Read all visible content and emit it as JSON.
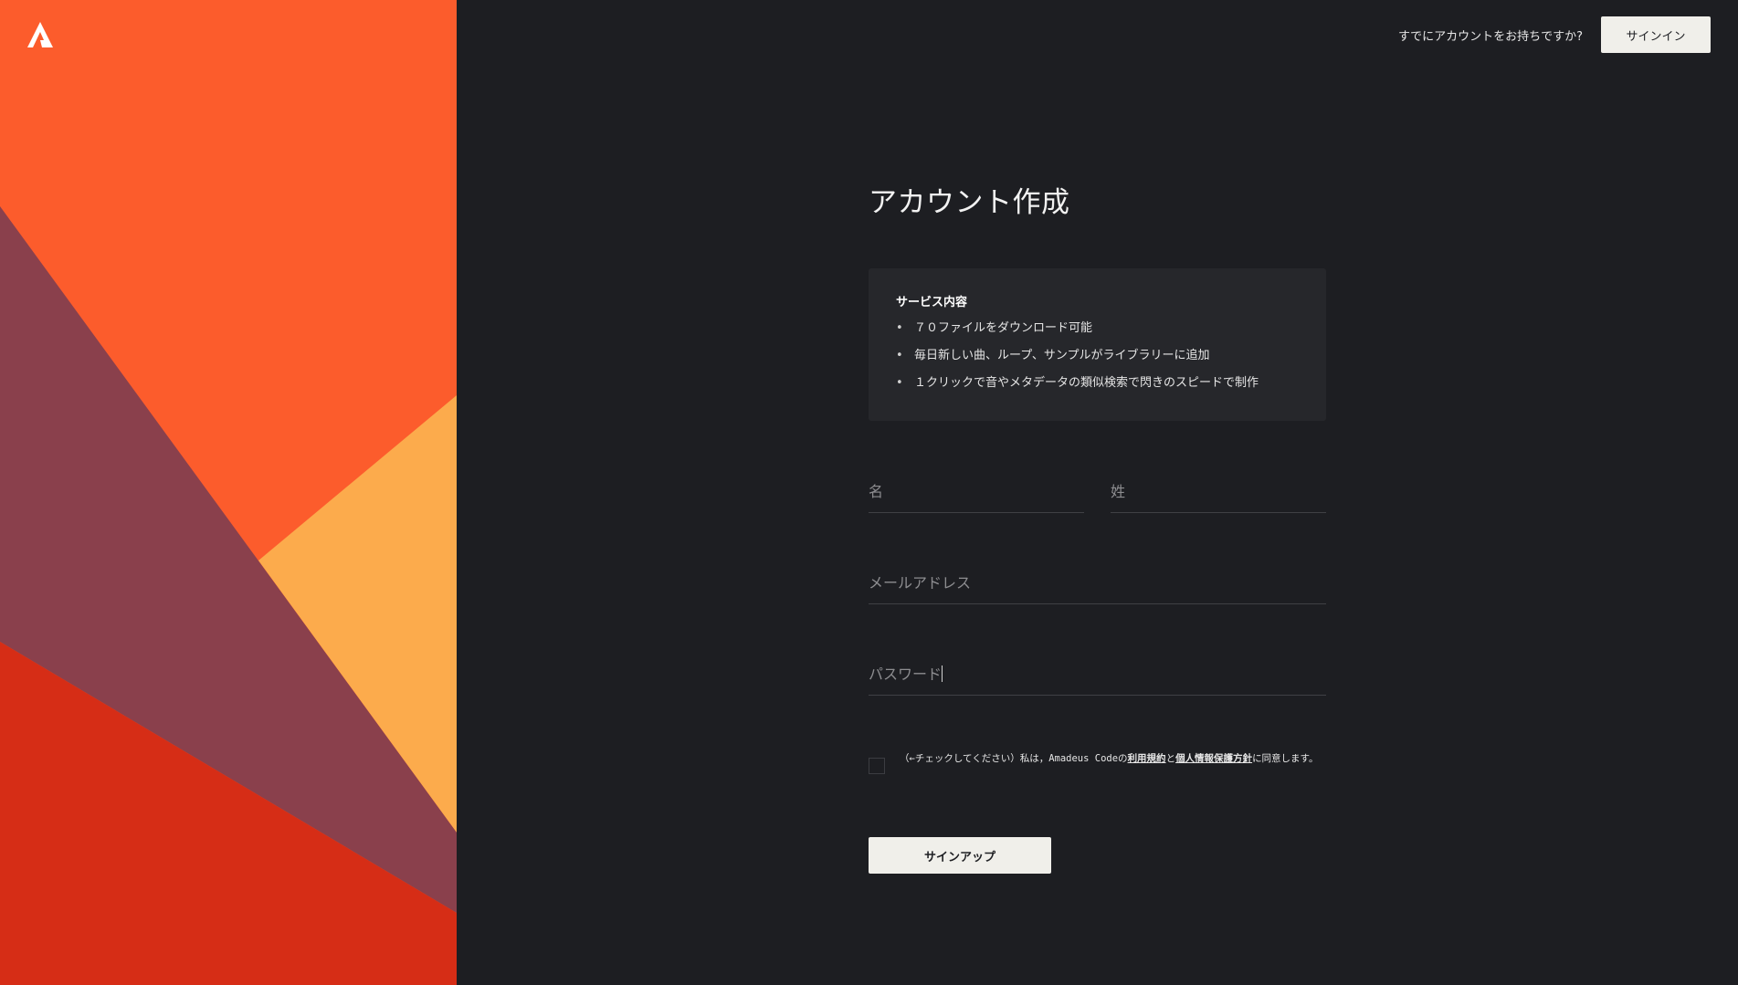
{
  "brand": {
    "logo_icon": "amadeus-code-logo-icon",
    "colors": {
      "orange": "#fc5c2c",
      "plum": "#8a404c",
      "amber": "#fcab4c",
      "red": "#d62d16",
      "background": "#1d1e22",
      "button": "#f0efea"
    }
  },
  "header": {
    "prompt": "すでにアカウントをお持ちですか?",
    "signin_label": "サインイン"
  },
  "main": {
    "title": "アカウント作成",
    "service": {
      "title": "サービス内容",
      "items": [
        "７０ファイルをダウンロード可能",
        "毎日新しい曲、ループ、サンプルがライブラリーに追加",
        "１クリックで音やメタデータの類似検索で閃きのスピードで制作"
      ]
    },
    "form": {
      "first_name_placeholder": "名",
      "last_name_placeholder": "姓",
      "email_placeholder": "メールアドレス",
      "password_placeholder": "パスワード",
      "consent_prefix": "（←チェックしてください）私は，Amadeus Codeの",
      "terms_link": "利用規約",
      "consent_and": "と",
      "privacy_link": "個人情報保護方針",
      "consent_suffix": "に同意します。",
      "signup_label": "サインアップ"
    }
  }
}
